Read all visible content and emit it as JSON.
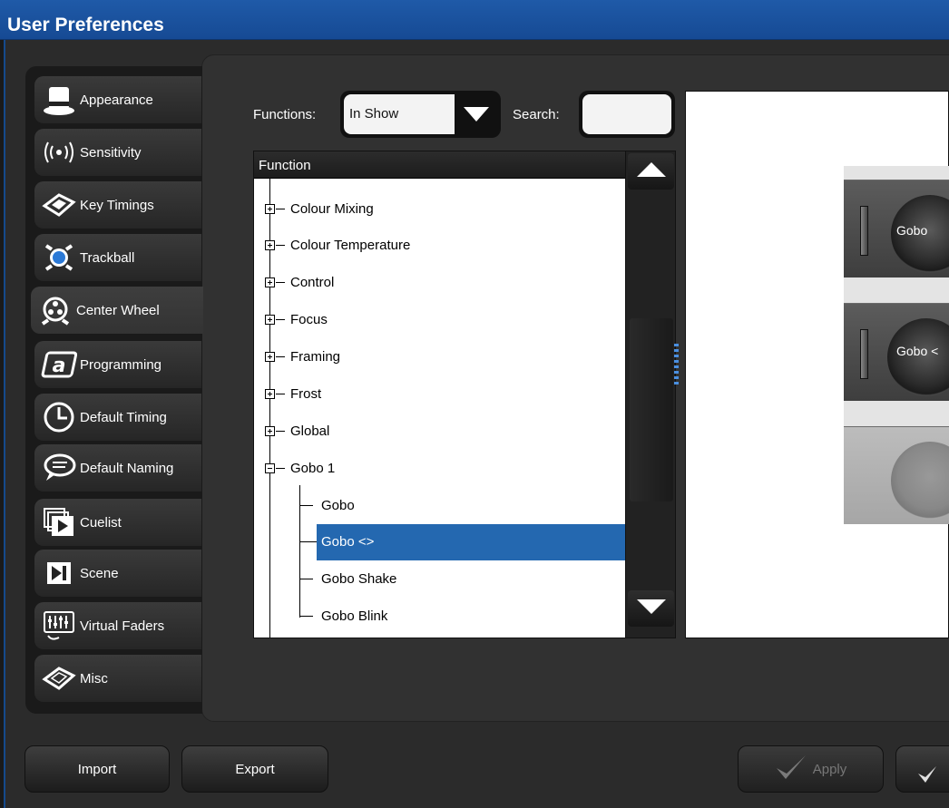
{
  "window": {
    "title": "User Preferences"
  },
  "sidebar": {
    "items": [
      {
        "label": "Appearance",
        "icon": "top-hat-icon"
      },
      {
        "label": "Sensitivity",
        "icon": "signal-waves-icon"
      },
      {
        "label": "Key Timings",
        "icon": "key-icon"
      },
      {
        "label": "Trackball",
        "icon": "trackball-icon"
      },
      {
        "label": "Center Wheel",
        "icon": "wheel-icon",
        "active": true
      },
      {
        "label": "Programming",
        "icon": "at-sign-icon"
      },
      {
        "label": "Default Timing",
        "icon": "clock-icon"
      },
      {
        "label": "Default Naming",
        "icon": "speech-bubble-icon"
      },
      {
        "label": "Cuelist",
        "icon": "cuelist-icon"
      },
      {
        "label": "Scene",
        "icon": "scene-icon"
      },
      {
        "label": "Virtual Faders",
        "icon": "faders-icon"
      },
      {
        "label": "Misc",
        "icon": "misc-key-icon"
      }
    ]
  },
  "filters": {
    "functions_label": "Functions:",
    "functions_value": "In Show",
    "search_label": "Search:",
    "search_value": ""
  },
  "tree": {
    "header": "Function",
    "rows": [
      {
        "label": "Colour Mixing",
        "type": "group"
      },
      {
        "label": "Colour Temperature",
        "type": "group"
      },
      {
        "label": "Control",
        "type": "group"
      },
      {
        "label": "Focus",
        "type": "group"
      },
      {
        "label": "Framing",
        "type": "group"
      },
      {
        "label": "Frost",
        "type": "group"
      },
      {
        "label": "Global",
        "type": "group"
      },
      {
        "label": "Gobo 1",
        "type": "group-open"
      },
      {
        "label": "Gobo",
        "type": "child"
      },
      {
        "label": "Gobo <>",
        "type": "child",
        "selected": true
      },
      {
        "label": "Gobo Shake",
        "type": "child"
      },
      {
        "label": "Gobo Blink",
        "type": "child"
      }
    ]
  },
  "preview": {
    "wheel1_label": "Gobo",
    "wheel2_label": "Gobo <"
  },
  "footer": {
    "import": "Import",
    "export": "Export",
    "apply": "Apply"
  },
  "colors": {
    "title_bar": "#1c56a3",
    "selection": "#2468b0",
    "background": "#2b2b2b"
  }
}
